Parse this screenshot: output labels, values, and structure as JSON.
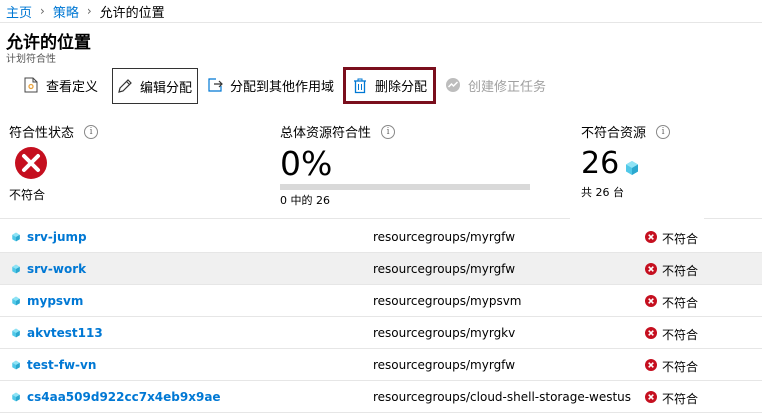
{
  "breadcrumb": {
    "items": [
      "主页",
      "策略"
    ],
    "current": "允许的位置"
  },
  "page": {
    "title": "允许的位置",
    "subtitle": "计划符合性"
  },
  "toolbar": {
    "view_definition": "查看定义",
    "edit_assignment": "编辑分配",
    "assign_other_scope": "分配到其他作用域",
    "delete_assignment": "删除分配",
    "create_remediation": "创建修正任务"
  },
  "summary": {
    "compliance_state": {
      "label": "符合性状态",
      "info": "i",
      "value": "不符合"
    },
    "overall_compliance": {
      "label": "总体资源符合性",
      "info": "i",
      "percent": "0%",
      "progress": 0,
      "caption": "0 中的 26"
    },
    "noncompliant_resources": {
      "label": "不符合资源",
      "info": "i",
      "count": "26",
      "caption": "共 26 台"
    }
  },
  "resources": [
    {
      "name": "srv-jump",
      "path": "resourcegroups/myrgfw",
      "status": "不符合"
    },
    {
      "name": "srv-work",
      "path": "resourcegroups/myrgfw",
      "status": "不符合"
    },
    {
      "name": "mypsvm",
      "path": "resourcegroups/mypsvm",
      "status": "不符合"
    },
    {
      "name": "akvtest113",
      "path": "resourcegroups/myrgkv",
      "status": "不符合"
    },
    {
      "name": "test-fw-vn",
      "path": "resourcegroups/myrgfw",
      "status": "不符合"
    },
    {
      "name": "cs4aa509d922cc7x4eb9x9ae",
      "path": "resourcegroups/cloud-shell-storage-westus",
      "status": "不符合"
    }
  ],
  "colors": {
    "link": "#0078d4",
    "error": "#c50f1f",
    "highlight": "#7a0e1d",
    "progress_fill": "#107c10"
  }
}
